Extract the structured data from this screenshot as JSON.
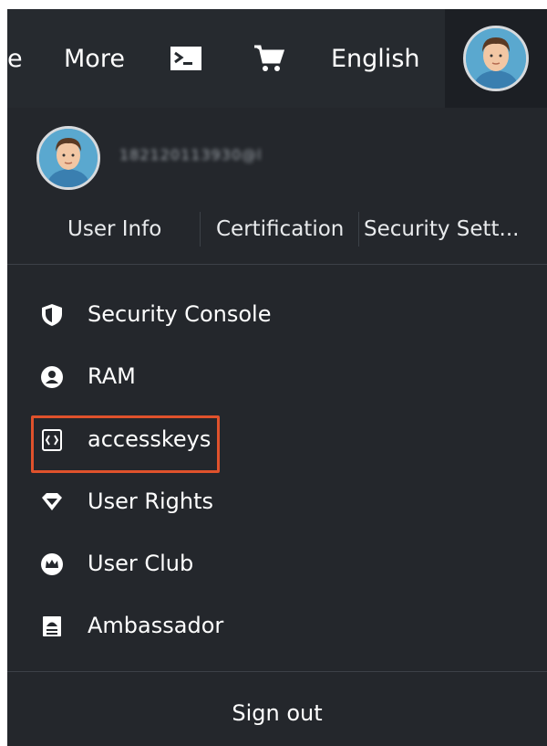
{
  "topbar": {
    "partial_label": "e",
    "more_label": "More",
    "terminal_icon": "terminal-icon",
    "cart_icon": "cart-icon",
    "language_label": "English"
  },
  "profile": {
    "username": "182120113930@l"
  },
  "subnav": {
    "items": [
      {
        "label": "User Info"
      },
      {
        "label": "Certification"
      },
      {
        "label": "Security Sett..."
      }
    ]
  },
  "menu": {
    "items": [
      {
        "label": "Security Console",
        "icon": "shield-icon"
      },
      {
        "label": "RAM",
        "icon": "user-circle-icon"
      },
      {
        "label": "accesskeys",
        "icon": "key-code-icon"
      },
      {
        "label": "User Rights",
        "icon": "diamond-icon"
      },
      {
        "label": "User Club",
        "icon": "crown-icon"
      },
      {
        "label": "Ambassador",
        "icon": "ambassador-icon"
      }
    ],
    "highlighted": "accesskeys"
  },
  "footer": {
    "signout_label": "Sign out"
  },
  "colors": {
    "topbar_bg": "#262a2f",
    "menu_bg": "#24272c",
    "highlight": "#e0522c"
  }
}
